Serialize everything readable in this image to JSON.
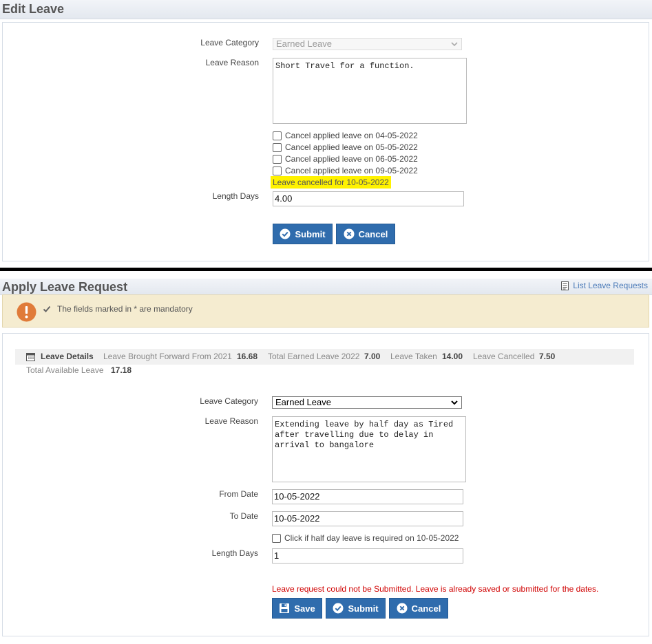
{
  "edit": {
    "title": "Edit Leave",
    "leave_category_label": "Leave Category",
    "leave_category_value": "Earned Leave",
    "leave_reason_label": "Leave Reason",
    "leave_reason_value": "Short Travel for a function.",
    "cancel_options": [
      "Cancel applied leave on 04-05-2022",
      "Cancel applied leave on 05-05-2022",
      "Cancel applied leave on 06-05-2022",
      "Cancel applied leave on 09-05-2022"
    ],
    "cancelled_note": "Leave cancelled for 10-05-2022",
    "length_days_label": "Length Days",
    "length_days_value": "4.00",
    "submit_label": "Submit",
    "cancel_label": "Cancel"
  },
  "apply": {
    "title": "Apply Leave Request",
    "list_link": "List Leave Requests",
    "notice": "The fields marked in * are mandatory",
    "summary": {
      "heading": "Leave Details",
      "brought_forward_label": "Leave Brought Forward From 2021",
      "brought_forward_value": "16.68",
      "total_earned_label": "Total Earned Leave 2022",
      "total_earned_value": "7.00",
      "taken_label": "Leave Taken",
      "taken_value": "14.00",
      "cancelled_label": "Leave Cancelled",
      "cancelled_value": "7.50",
      "available_label": "Total Available Leave",
      "available_value": "17.18"
    },
    "leave_category_label": "Leave Category",
    "leave_category_value": "Earned Leave",
    "leave_reason_label": "Leave Reason",
    "leave_reason_value": "Extending leave by half day as Tired\nafter travelling due to delay in\narrival to bangalore",
    "from_date_label": "From Date",
    "from_date_value": "10-05-2022",
    "to_date_label": "To Date",
    "to_date_value": "10-05-2022",
    "half_day_label": "Click if half day leave is required on 10-05-2022",
    "length_days_label": "Length Days",
    "length_days_value": "1",
    "error": "Leave request could not be Submitted. Leave is already saved or submitted for the dates.",
    "save_label": "Save",
    "submit_label": "Submit",
    "cancel_label": "Cancel"
  },
  "colors": {
    "button": "#2f6cad",
    "warning_bg": "#f5ecd0",
    "warning_icon": "#e07b39",
    "error_text": "#d00000",
    "highlight": "#fff200",
    "link": "#4a7ab8"
  }
}
